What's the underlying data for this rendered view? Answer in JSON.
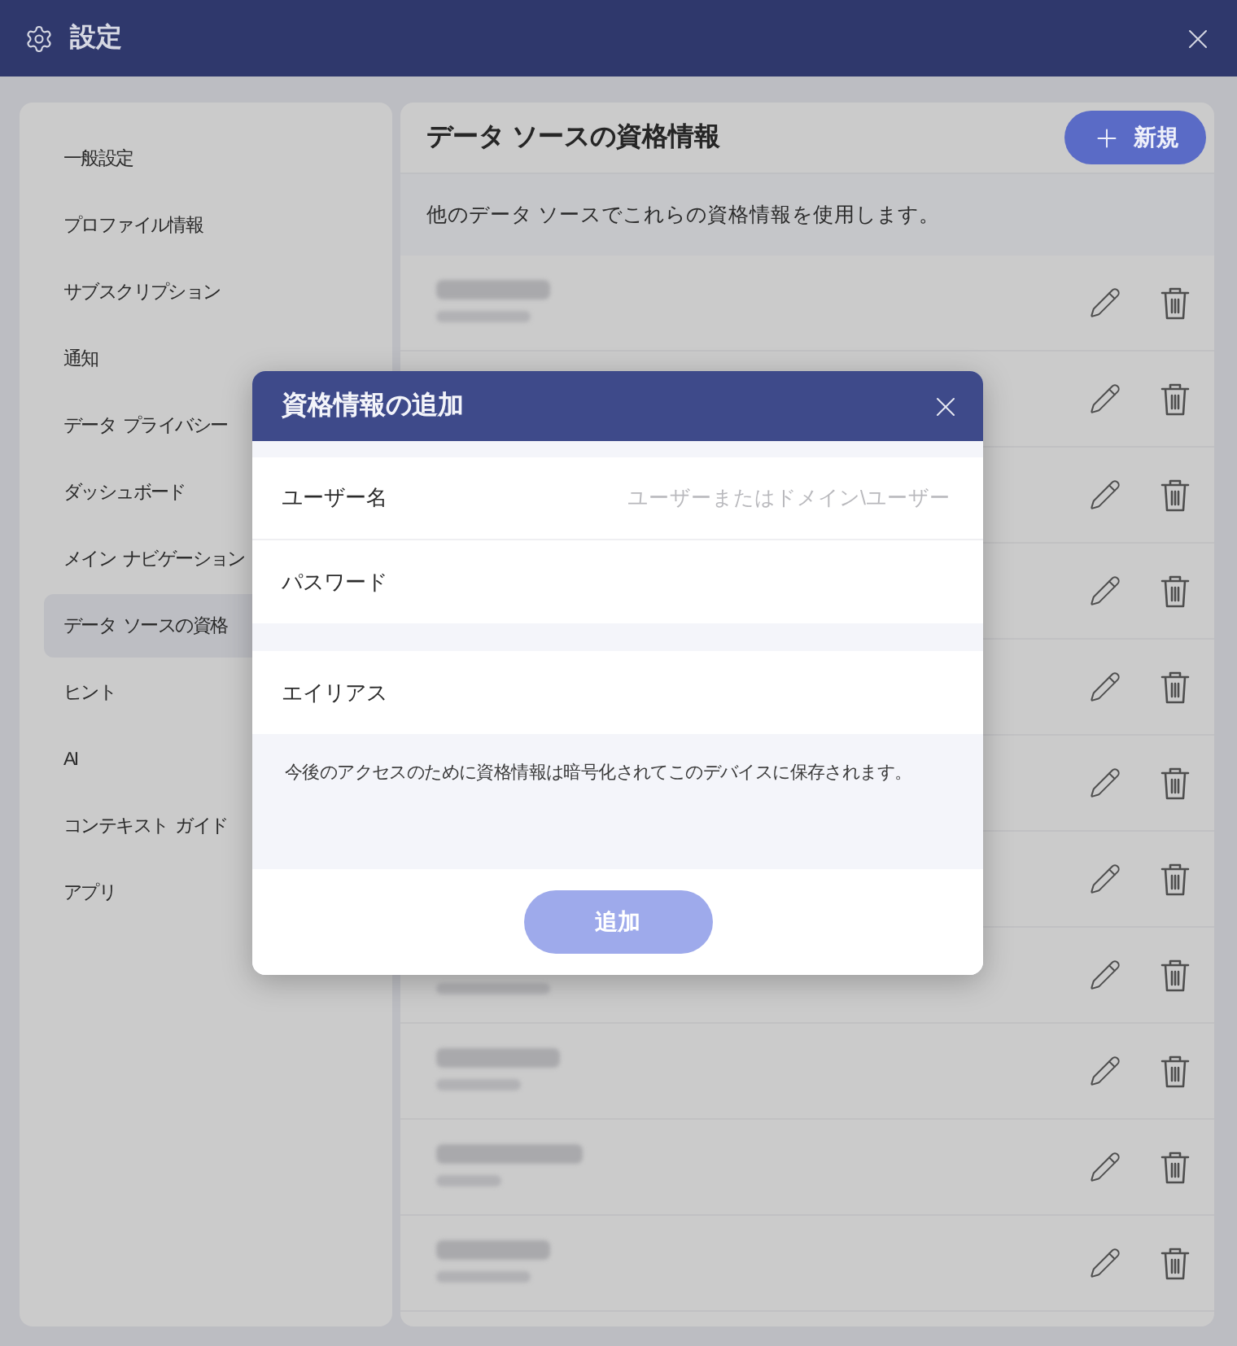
{
  "window": {
    "title": "設定"
  },
  "sidebar": {
    "items": [
      {
        "label": "一般設定",
        "selected": false
      },
      {
        "label": "プロファイル情報",
        "selected": false
      },
      {
        "label": "サブスクリプション",
        "selected": false
      },
      {
        "label": "通知",
        "selected": false
      },
      {
        "label": "データ プライバシー",
        "selected": false
      },
      {
        "label": "ダッシュボード",
        "selected": false
      },
      {
        "label": "メイン ナビゲーション",
        "selected": false
      },
      {
        "label": "データ ソースの資格",
        "selected": true
      },
      {
        "label": "ヒント",
        "selected": false
      },
      {
        "label": "AI",
        "selected": false
      },
      {
        "label": "コンテキスト ガイド",
        "selected": false
      },
      {
        "label": "アプリ",
        "selected": false
      }
    ]
  },
  "content": {
    "title": "データ ソースの資格情報",
    "new_button": {
      "label": "新規"
    },
    "description": "他のデータ ソースでこれらの資格情報を使用します。",
    "credentials": [
      {
        "title_blurred": true,
        "detail_blurred": true
      },
      {
        "title_blurred": false,
        "detail_blurred": false
      },
      {
        "title_blurred": false,
        "detail_blurred": false
      },
      {
        "title_blurred": false,
        "detail_blurred": false
      },
      {
        "title_blurred": false,
        "detail_blurred": false
      },
      {
        "title_blurred": false,
        "detail_blurred": false
      },
      {
        "title_blurred": false,
        "detail_blurred": false
      },
      {
        "title_blurred": false,
        "detail_blurred": true
      },
      {
        "title_blurred": true,
        "detail_blurred": true
      },
      {
        "title_blurred": true,
        "detail_blurred": true
      },
      {
        "title_blurred": true,
        "detail_blurred": true
      }
    ]
  },
  "dialog": {
    "title": "資格情報の追加",
    "field_groups": [
      {
        "fields": [
          {
            "label": "ユーザー名",
            "placeholder": "ユーザーまたはドメイン\\ユーザー"
          },
          {
            "label": "パスワード"
          }
        ]
      },
      {
        "fields": [
          {
            "label": "エイリアス"
          }
        ]
      }
    ],
    "note": "今後のアクセスのために資格情報は暗号化されてこのデバイスに保存されます。",
    "add_button": {
      "label": "追加",
      "disabled": true
    }
  }
}
